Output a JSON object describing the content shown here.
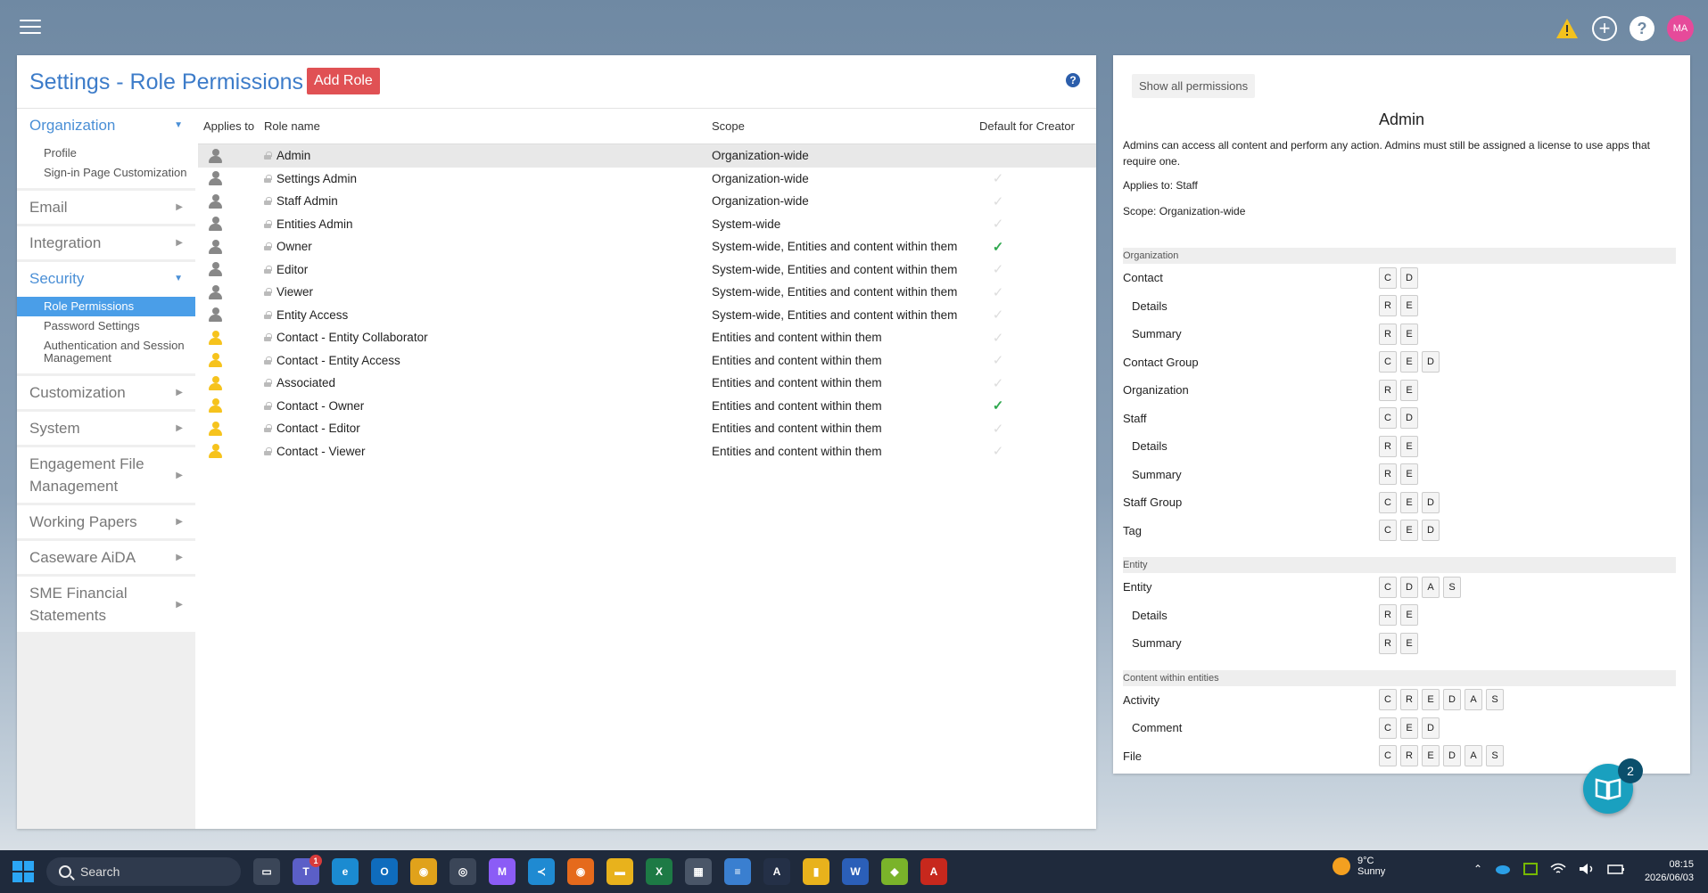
{
  "header": {
    "page_title": "Settings - Role Permissions",
    "add_role_label": "Add Role",
    "help_label": "?",
    "avatar_initials": "MA",
    "add_icon": "+",
    "top_help": "?"
  },
  "sidebar": {
    "sections": [
      {
        "label": "Organization",
        "open": true,
        "items": [
          "Profile",
          "Sign-in Page Customization"
        ]
      },
      {
        "label": "Email",
        "open": false
      },
      {
        "label": "Integration",
        "open": false
      },
      {
        "label": "Security",
        "open": true,
        "items": [
          "Role Permissions",
          "Password Settings",
          "Authentication and Session Management"
        ],
        "active": "Role Permissions"
      },
      {
        "label": "Customization",
        "open": false
      },
      {
        "label": "System",
        "open": false
      },
      {
        "label": "Engagement File Management",
        "open": false
      },
      {
        "label": "Working Papers",
        "open": false
      },
      {
        "label": "Caseware AiDA",
        "open": false
      },
      {
        "label": "SME Financial Statements",
        "open": false
      }
    ]
  },
  "table": {
    "headers": {
      "applies": "Applies to",
      "name": "Role name",
      "scope": "Scope",
      "default": "Default for Creator"
    },
    "rows": [
      {
        "applies": "staff",
        "name": "Admin",
        "scope": "Organization-wide",
        "default": null,
        "selected": true
      },
      {
        "applies": "staff",
        "name": "Settings Admin",
        "scope": "Organization-wide",
        "default": false
      },
      {
        "applies": "staff",
        "name": "Staff Admin",
        "scope": "Organization-wide",
        "default": false
      },
      {
        "applies": "staff",
        "name": "Entities Admin",
        "scope": "System-wide",
        "default": false
      },
      {
        "applies": "staff",
        "name": "Owner",
        "scope": "System-wide, Entities and content within them",
        "default": true
      },
      {
        "applies": "staff",
        "name": "Editor",
        "scope": "System-wide, Entities and content within them",
        "default": false
      },
      {
        "applies": "staff",
        "name": "Viewer",
        "scope": "System-wide, Entities and content within them",
        "default": false
      },
      {
        "applies": "staff",
        "name": "Entity Access",
        "scope": "System-wide, Entities and content within them",
        "default": false
      },
      {
        "applies": "contact",
        "name": "Contact - Entity Collaborator",
        "scope": "Entities and content within them",
        "default": false
      },
      {
        "applies": "contact",
        "name": "Contact - Entity Access",
        "scope": "Entities and content within them",
        "default": false
      },
      {
        "applies": "contact",
        "name": "Associated",
        "scope": "Entities and content within them",
        "default": false
      },
      {
        "applies": "contact",
        "name": "Contact - Owner",
        "scope": "Entities and content within them",
        "default": true
      },
      {
        "applies": "contact",
        "name": "Contact - Editor",
        "scope": "Entities and content within them",
        "default": false
      },
      {
        "applies": "contact",
        "name": "Contact - Viewer",
        "scope": "Entities and content within them",
        "default": false
      }
    ]
  },
  "detail": {
    "show_all_label": "Show all permissions",
    "title": "Admin",
    "description": "Admins can access all content and perform any action. Admins must still be assigned a license to use apps that require one.",
    "applies_to": "Applies to: Staff",
    "scope": "Scope: Organization-wide",
    "sections": [
      {
        "title": "Organization",
        "rows": [
          {
            "label": "Contact",
            "indent": false,
            "perms": [
              "C",
              "D"
            ]
          },
          {
            "label": "Details",
            "indent": true,
            "perms": [
              "R",
              "E"
            ]
          },
          {
            "label": "Summary",
            "indent": true,
            "perms": [
              "R",
              "E"
            ]
          },
          {
            "label": "Contact Group",
            "indent": false,
            "perms": [
              "C",
              "E",
              "D"
            ]
          },
          {
            "label": "Organization",
            "indent": false,
            "perms": [
              "R",
              "E"
            ]
          },
          {
            "label": "Staff",
            "indent": false,
            "perms": [
              "C",
              "D"
            ]
          },
          {
            "label": "Details",
            "indent": true,
            "perms": [
              "R",
              "E"
            ]
          },
          {
            "label": "Summary",
            "indent": true,
            "perms": [
              "R",
              "E"
            ]
          },
          {
            "label": "Staff Group",
            "indent": false,
            "perms": [
              "C",
              "E",
              "D"
            ]
          },
          {
            "label": "Tag",
            "indent": false,
            "perms": [
              "C",
              "E",
              "D"
            ]
          }
        ]
      },
      {
        "title": "Entity",
        "rows": [
          {
            "label": "Entity",
            "indent": false,
            "perms": [
              "C",
              "D",
              "A",
              "S"
            ]
          },
          {
            "label": "Details",
            "indent": true,
            "perms": [
              "R",
              "E"
            ]
          },
          {
            "label": "Summary",
            "indent": true,
            "perms": [
              "R",
              "E"
            ]
          }
        ]
      },
      {
        "title": "Content within entities",
        "rows": [
          {
            "label": "Activity",
            "indent": false,
            "perms": [
              "C",
              "R",
              "E",
              "D",
              "A",
              "S"
            ]
          },
          {
            "label": "Comment",
            "indent": true,
            "perms": [
              "C",
              "E",
              "D"
            ]
          },
          {
            "label": "File",
            "indent": false,
            "perms": [
              "C",
              "R",
              "E",
              "D",
              "A",
              "S"
            ]
          }
        ]
      }
    ]
  },
  "help_fab": {
    "badge": "2"
  },
  "taskbar": {
    "search_label": "Search",
    "apps": [
      {
        "name": "task-view",
        "color": "#3b4658",
        "glyph": "▭"
      },
      {
        "name": "teams",
        "color": "#5b5fc7",
        "glyph": "T",
        "badge": "1"
      },
      {
        "name": "edge",
        "color": "#1b8bd1",
        "glyph": "e"
      },
      {
        "name": "outlook",
        "color": "#0f6cbd",
        "glyph": "O"
      },
      {
        "name": "chrome",
        "color": "#e0a21b",
        "glyph": "◉"
      },
      {
        "name": "app-circle",
        "color": "#3b4658",
        "glyph": "◎"
      },
      {
        "name": "m365",
        "color": "#8b5cf6",
        "glyph": "M"
      },
      {
        "name": "vscode",
        "color": "#1f8ad2",
        "glyph": "≺"
      },
      {
        "name": "firefox",
        "color": "#e56a1c",
        "glyph": "◉"
      },
      {
        "name": "file-explorer",
        "color": "#e8b21c",
        "glyph": "▬"
      },
      {
        "name": "excel",
        "color": "#1d7a45",
        "glyph": "X"
      },
      {
        "name": "calculator",
        "color": "#4a5668",
        "glyph": "▦"
      },
      {
        "name": "notepad",
        "color": "#3a7fd0",
        "glyph": "≡"
      },
      {
        "name": "app-a",
        "color": "#243047",
        "glyph": "A"
      },
      {
        "name": "power-bi",
        "color": "#e8b21c",
        "glyph": "▮"
      },
      {
        "name": "word",
        "color": "#2b5fb8",
        "glyph": "W"
      },
      {
        "name": "app-green",
        "color": "#7ab32a",
        "glyph": "◆"
      },
      {
        "name": "acrobat",
        "color": "#c7281d",
        "glyph": "A"
      }
    ],
    "weather_temp": "9°C",
    "weather_cond": "Sunny",
    "tray_arrow": "⌃",
    "time": "08:15",
    "date": "2026/06/03"
  }
}
